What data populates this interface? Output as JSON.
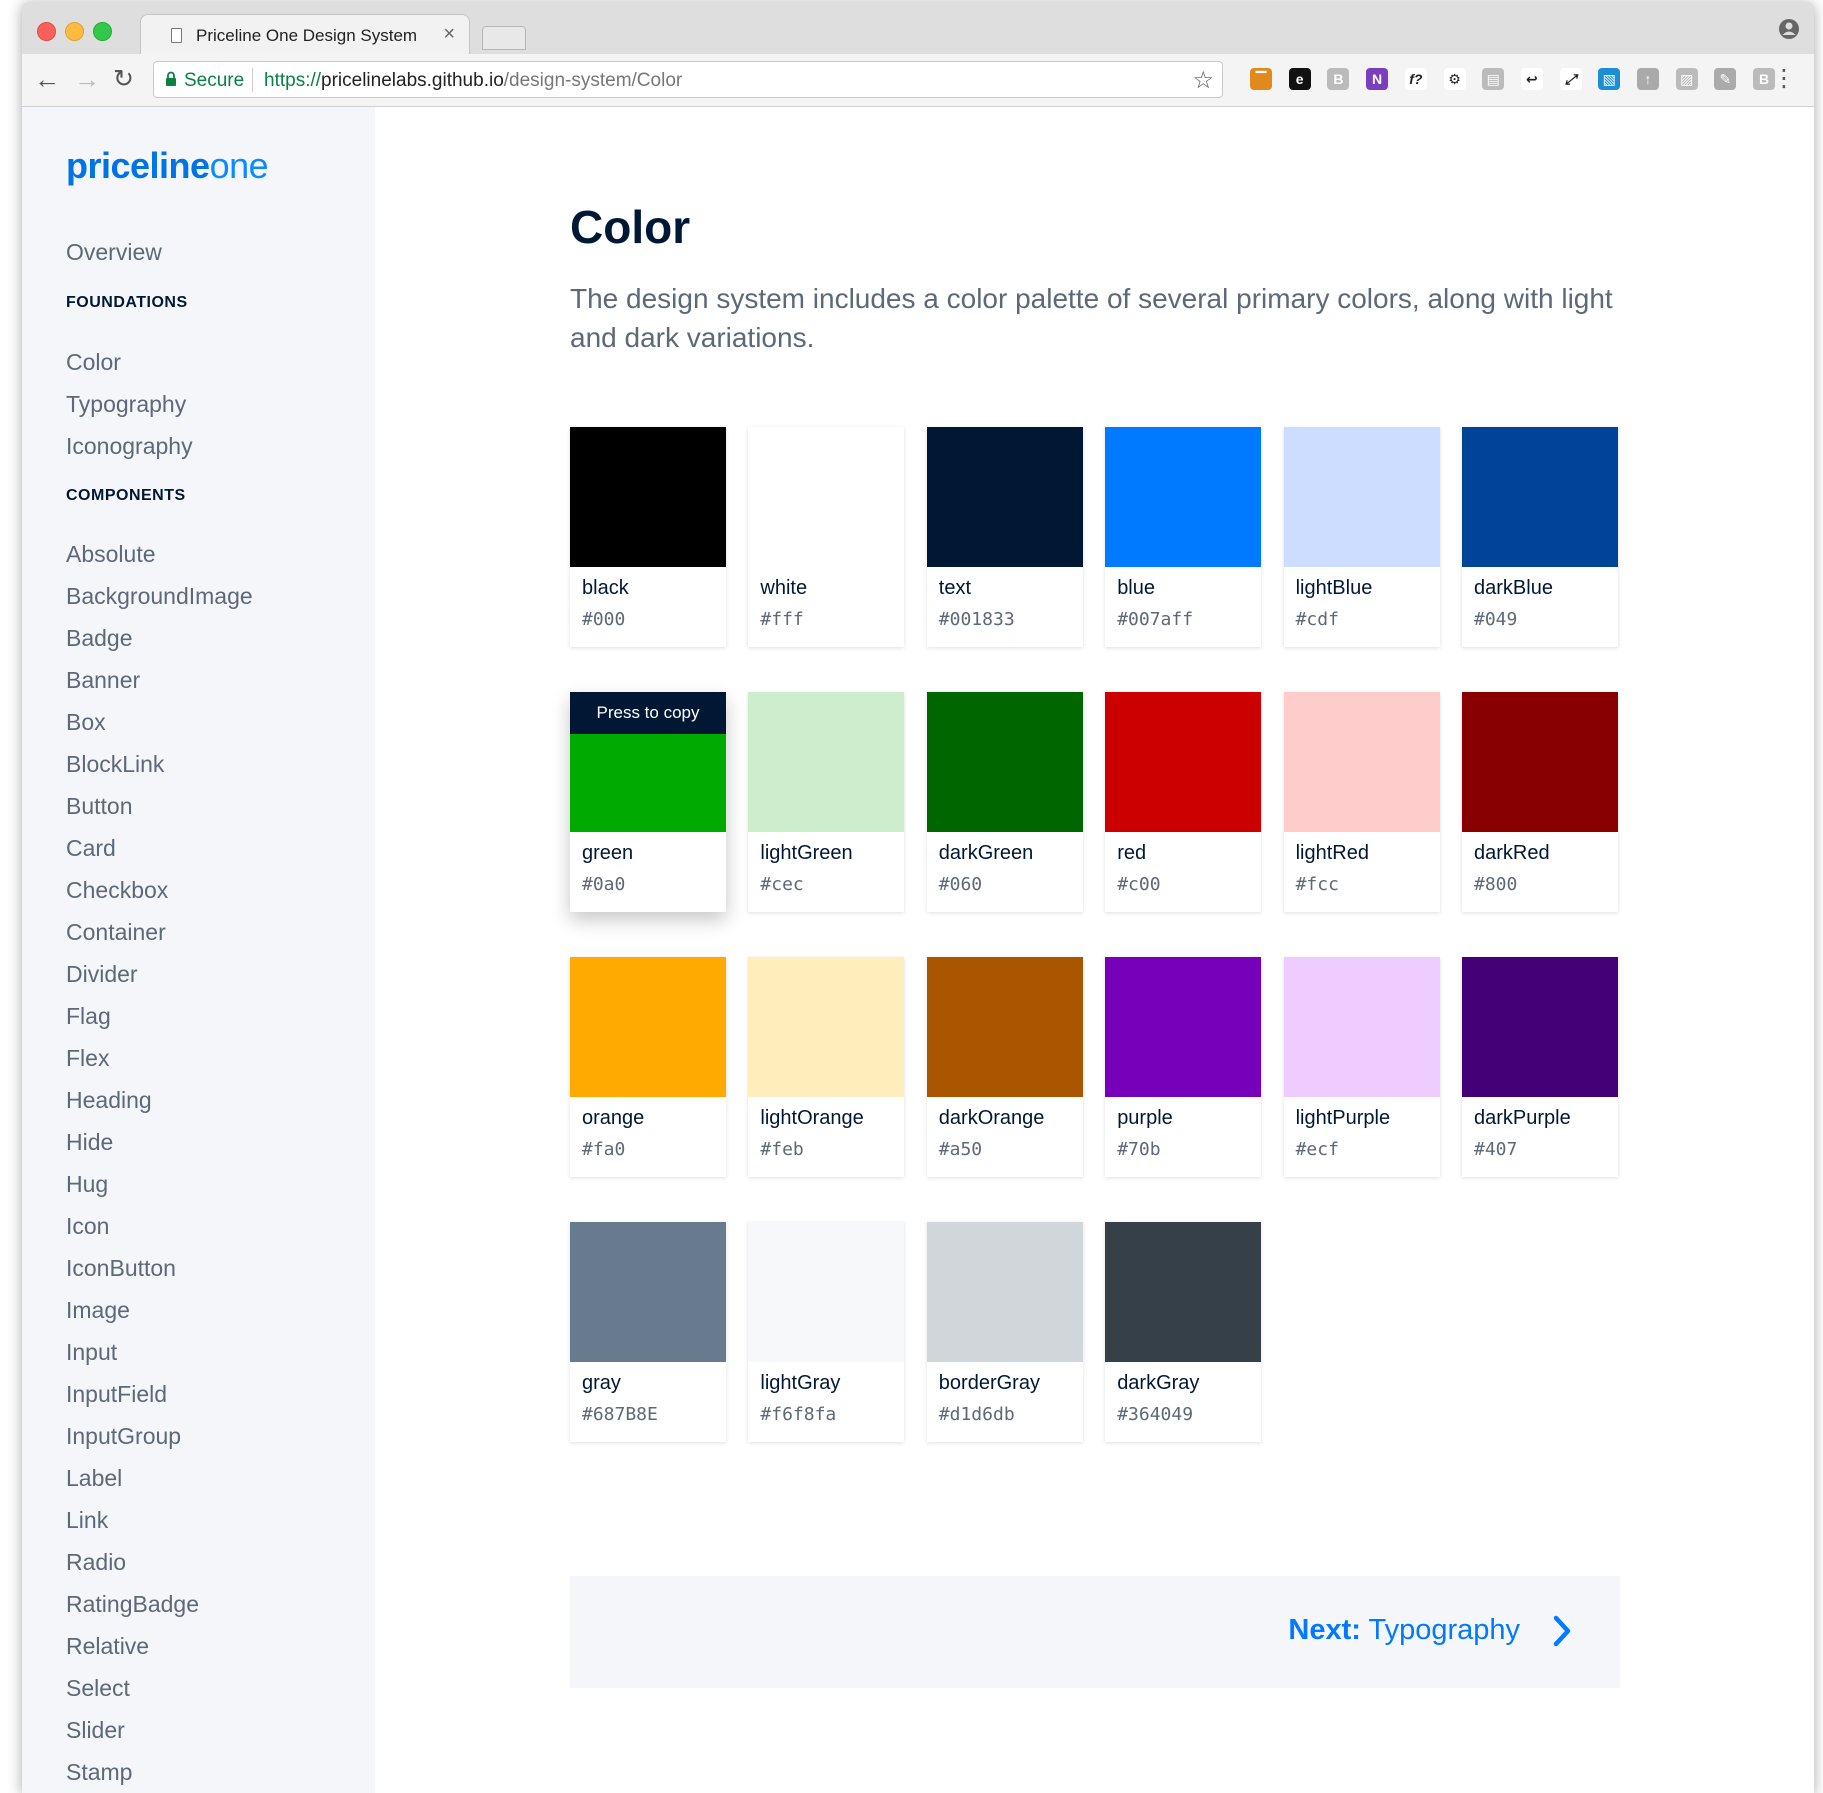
{
  "browser": {
    "tab_title": "Priceline One Design System",
    "close_glyph": "×",
    "secure_label": "Secure",
    "url_scheme": "https://",
    "url_host": "pricelinelabs.github.io",
    "url_path": "/design-system/Color",
    "extensions": [
      "bookmark-flag-icon",
      "evernote-icon",
      "readability-icon",
      "onenote-icon",
      "formula-icon",
      "wrench-icon",
      "page-icon",
      "tab-icon",
      "resize-icon",
      "screenshot-icon",
      "extension-icon",
      "chart-icon",
      "pen-icon",
      "b-icon"
    ]
  },
  "sidebar": {
    "logo_bold": "priceline",
    "logo_light": "one",
    "overview": "Overview",
    "foundations_heading": "FOUNDATIONS",
    "foundations": [
      "Color",
      "Typography",
      "Iconography"
    ],
    "components_heading": "COMPONENTS",
    "components": [
      "Absolute",
      "BackgroundImage",
      "Badge",
      "Banner",
      "Box",
      "BlockLink",
      "Button",
      "Card",
      "Checkbox",
      "Container",
      "Divider",
      "Flag",
      "Flex",
      "Heading",
      "Hide",
      "Hug",
      "Icon",
      "IconButton",
      "Image",
      "Input",
      "InputField",
      "InputGroup",
      "Label",
      "Link",
      "Radio",
      "RatingBadge",
      "Relative",
      "Select",
      "Slider",
      "Stamp"
    ]
  },
  "main": {
    "title": "Color",
    "lead": "The design system includes a color palette of several primary colors, along with light and dark variations.",
    "tooltip": "Press to copy",
    "swatches": [
      {
        "name": "black",
        "hex": "#000",
        "color": "#000000"
      },
      {
        "name": "white",
        "hex": "#fff",
        "color": "#ffffff"
      },
      {
        "name": "text",
        "hex": "#001833",
        "color": "#001833"
      },
      {
        "name": "blue",
        "hex": "#007aff",
        "color": "#007aff"
      },
      {
        "name": "lightBlue",
        "hex": "#cdf",
        "color": "#ccddff"
      },
      {
        "name": "darkBlue",
        "hex": "#049",
        "color": "#004499"
      },
      {
        "name": "green",
        "hex": "#0a0",
        "color": "#00aa00"
      },
      {
        "name": "lightGreen",
        "hex": "#cec",
        "color": "#cceecc"
      },
      {
        "name": "darkGreen",
        "hex": "#060",
        "color": "#006600"
      },
      {
        "name": "red",
        "hex": "#c00",
        "color": "#cc0000"
      },
      {
        "name": "lightRed",
        "hex": "#fcc",
        "color": "#ffcccc"
      },
      {
        "name": "darkRed",
        "hex": "#800",
        "color": "#880000"
      },
      {
        "name": "orange",
        "hex": "#fa0",
        "color": "#ffaa00"
      },
      {
        "name": "lightOrange",
        "hex": "#feb",
        "color": "#ffeebb"
      },
      {
        "name": "darkOrange",
        "hex": "#a50",
        "color": "#aa5500"
      },
      {
        "name": "purple",
        "hex": "#70b",
        "color": "#7700bb"
      },
      {
        "name": "lightPurple",
        "hex": "#ecf",
        "color": "#eeccff"
      },
      {
        "name": "darkPurple",
        "hex": "#407",
        "color": "#440077"
      },
      {
        "name": "gray",
        "hex": "#687B8E",
        "color": "#687b8e"
      },
      {
        "name": "lightGray",
        "hex": "#f6f8fa",
        "color": "#f6f8fa"
      },
      {
        "name": "borderGray",
        "hex": "#d1d6db",
        "color": "#d1d6db"
      },
      {
        "name": "darkGray",
        "hex": "#364049",
        "color": "#364049"
      }
    ],
    "next_label": "Next:",
    "next_value": "Typography"
  },
  "colors": {
    "accent": "#007aff",
    "text": "#001833",
    "muted": "#5d6878",
    "sidebar_bg": "#f5f6f9"
  }
}
